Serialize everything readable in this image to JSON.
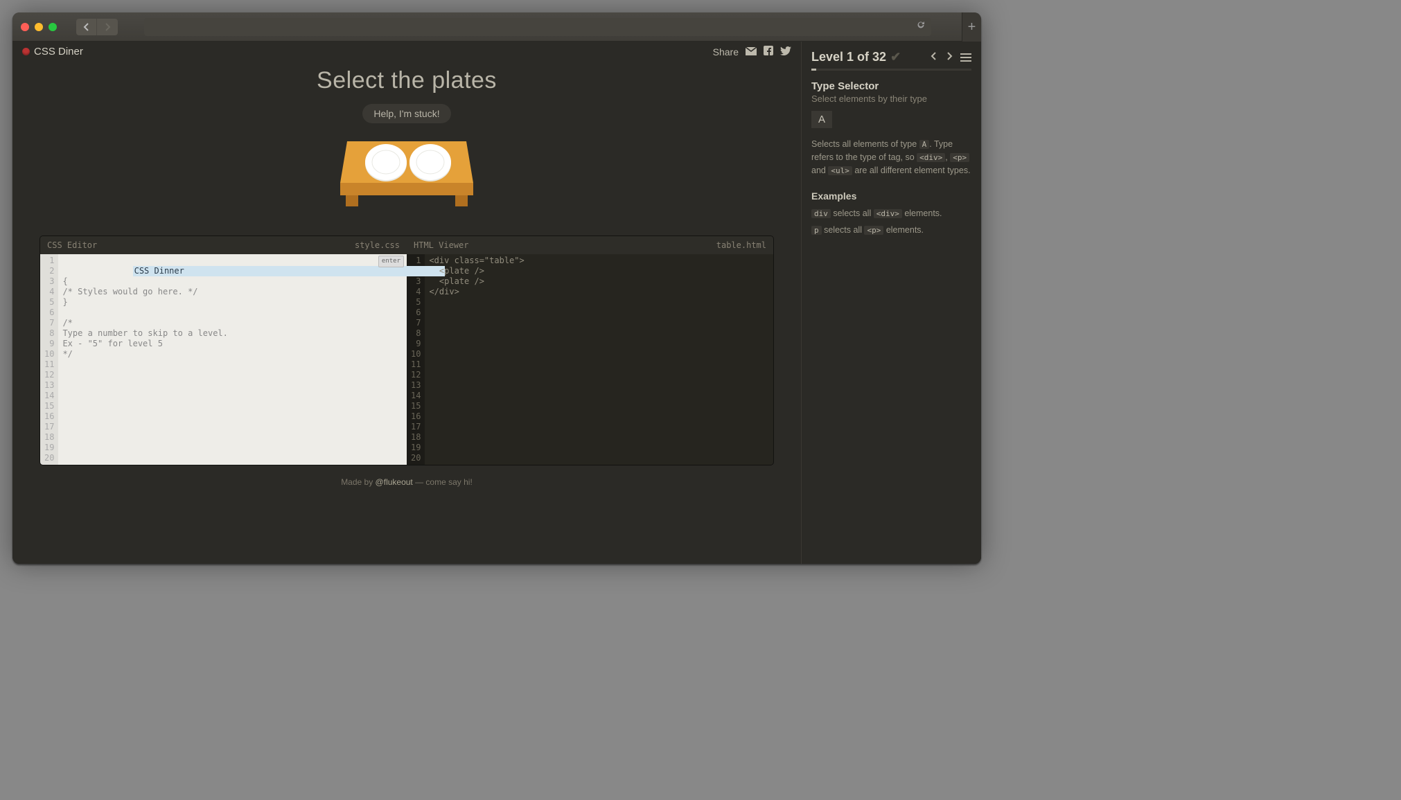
{
  "app": {
    "title": "CSS Diner"
  },
  "share": {
    "label": "Share"
  },
  "hero": {
    "title": "Select the plates",
    "help": "Help, I'm stuck!"
  },
  "editors": {
    "css": {
      "title": "CSS Editor",
      "filename": "style.css",
      "input_value": "CSS Dinner",
      "enter_label": "enter",
      "placeholder_lines": [
        "{",
        "/* Styles would go here. */",
        "}",
        "",
        "/*",
        "Type a number to skip to a level.",
        "Ex - \"5\" for level 5",
        "*/"
      ],
      "line_count": 20
    },
    "html": {
      "title": "HTML Viewer",
      "filename": "table.html",
      "lines": [
        "<div class=\"table\">",
        "  <plate />",
        "  <plate />",
        "</div>"
      ],
      "line_count": 20
    }
  },
  "footer": {
    "made_by": "Made by ",
    "author": "@flukeout",
    "suffix": " — come say hi!"
  },
  "sidebar": {
    "level_label": "Level 1 of 32",
    "progress_pct": 3,
    "selector_title": "Type Selector",
    "selector_subtitle": "Select elements by their type",
    "syntax": "A",
    "description_pre": "Selects all elements of type ",
    "description_code1": "A",
    "description_mid": ". Type refers to the type of tag, so ",
    "description_code2": "<div>",
    "description_sep1": ", ",
    "description_code3": "<p>",
    "description_sep2": " and ",
    "description_code4": "<ul>",
    "description_post": " are all different element types.",
    "examples_heading": "Examples",
    "examples": [
      {
        "code": "div",
        "text": " selects all ",
        "code2": "<div>",
        "suffix": " elements."
      },
      {
        "code": "p",
        "text": " selects all ",
        "code2": "<p>",
        "suffix": " elements."
      }
    ]
  }
}
